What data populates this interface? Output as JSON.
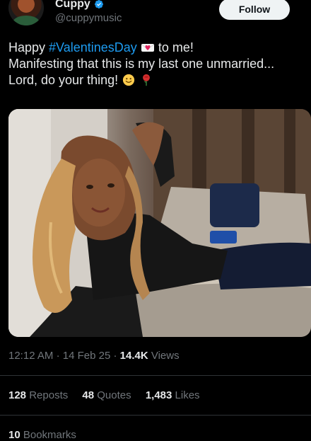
{
  "author": {
    "display_name": "Cuppy",
    "handle": "@cuppymusic",
    "follow_label": "Follow"
  },
  "tweet": {
    "line1_prefix": "Happy ",
    "hashtag": "#ValentinesDay",
    "line1_suffix": " to me!",
    "line2": "Manifesting that this is my last one unmarried...",
    "line3": "Lord, do your thing!",
    "emojis": [
      "heart-envelope",
      "smiley-face",
      "rose"
    ]
  },
  "meta": {
    "time": "12:12 AM",
    "date": "14 Feb 25",
    "views_count": "14.4K",
    "views_label": "Views"
  },
  "stats": {
    "reposts_count": "128",
    "reposts_label": "Reposts",
    "quotes_count": "48",
    "quotes_label": "Quotes",
    "likes_count": "1,483",
    "likes_label": "Likes"
  },
  "bookmarks": {
    "count": "10",
    "label": "Bookmarks"
  },
  "colors": {
    "background": "#000000",
    "text": "#e7e9ea",
    "muted": "#71767b",
    "link": "#1d9bf0",
    "divider": "#2f3336"
  }
}
